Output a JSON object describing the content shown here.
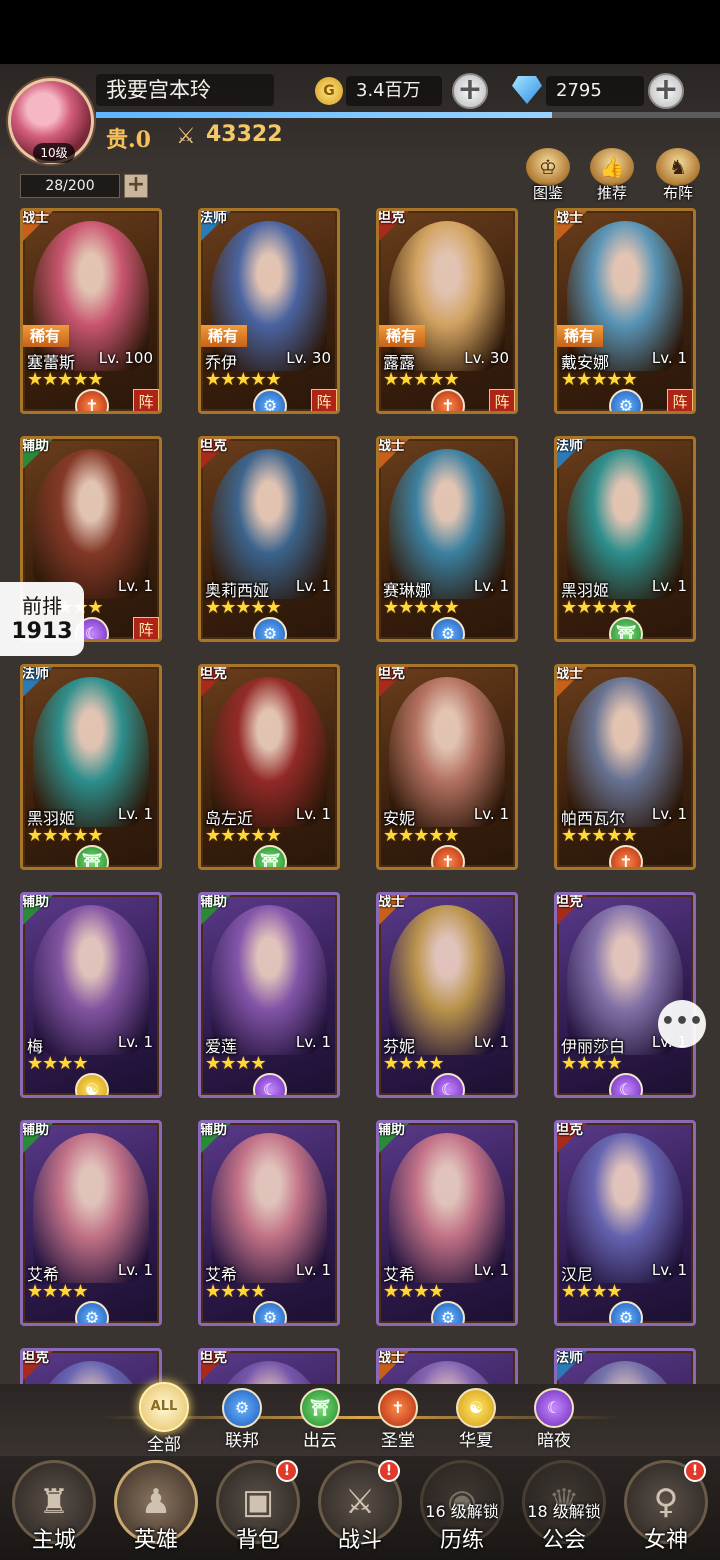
{
  "player": {
    "name": "我要宫本玲",
    "level": "10级",
    "vip": "贵.0",
    "power": "43322",
    "gold": "3.4百万",
    "gems": "2795",
    "exp_fraction": 0.73
  },
  "capacity": "28/200",
  "top_buttons": [
    {
      "label": "图鉴",
      "icon": "book-crown-icon"
    },
    {
      "label": "推荐",
      "icon": "thumbs-up-icon"
    },
    {
      "label": "布阵",
      "icon": "knight-icon"
    }
  ],
  "side_rank": {
    "label": "前排",
    "value": "1913"
  },
  "heroes": [
    {
      "role": "战士",
      "rare": "稀有",
      "name": "塞蕾斯",
      "lv": "Lv. 100",
      "stars": "★★★★★",
      "faction": "temple",
      "formation": true,
      "theme": "orange",
      "art": "#d65a7a"
    },
    {
      "role": "法师",
      "rare": "稀有",
      "name": "乔伊",
      "lv": "Lv. 30",
      "stars": "★★★★★",
      "faction": "union",
      "formation": true,
      "theme": "orange",
      "art": "#4a6ab0"
    },
    {
      "role": "坦克",
      "rare": "稀有",
      "name": "露露",
      "lv": "Lv. 30",
      "stars": "★★★★★",
      "faction": "temple",
      "formation": true,
      "theme": "orange",
      "art": "#e0b06a"
    },
    {
      "role": "战士",
      "rare": "稀有",
      "name": "戴安娜",
      "lv": "Lv. 1",
      "stars": "★★★★★",
      "faction": "union",
      "formation": true,
      "theme": "orange",
      "art": "#5aa0c8"
    },
    {
      "role": "辅助",
      "rare": "",
      "name": "",
      "lv": "Lv. 1",
      "stars": "★★★★★",
      "faction": "night",
      "formation": true,
      "theme": "orange",
      "art": "#8a3a2a"
    },
    {
      "role": "坦克",
      "rare": "",
      "name": "奥莉西娅",
      "lv": "Lv. 1",
      "stars": "★★★★★",
      "faction": "union",
      "formation": false,
      "theme": "orange",
      "art": "#3a6a9a"
    },
    {
      "role": "战士",
      "rare": "",
      "name": "赛琳娜",
      "lv": "Lv. 1",
      "stars": "★★★★★",
      "faction": "union",
      "formation": false,
      "theme": "orange",
      "art": "#3a8ab0"
    },
    {
      "role": "法师",
      "rare": "",
      "name": "黑羽姬",
      "lv": "Lv. 1",
      "stars": "★★★★★",
      "faction": "izumo",
      "formation": false,
      "theme": "orange",
      "art": "#2a9a9a"
    },
    {
      "role": "法师",
      "rare": "",
      "name": "黑羽姬",
      "lv": "Lv. 1",
      "stars": "★★★★★",
      "faction": "izumo",
      "formation": false,
      "theme": "orange",
      "art": "#2a9a9a"
    },
    {
      "role": "坦克",
      "rare": "",
      "name": "岛左近",
      "lv": "Lv. 1",
      "stars": "★★★★★",
      "faction": "izumo",
      "formation": false,
      "theme": "orange",
      "art": "#9a2a2a"
    },
    {
      "role": "坦克",
      "rare": "",
      "name": "安妮",
      "lv": "Lv. 1",
      "stars": "★★★★★",
      "faction": "temple",
      "formation": false,
      "theme": "orange",
      "art": "#c07a6a"
    },
    {
      "role": "战士",
      "rare": "",
      "name": "帕西瓦尔",
      "lv": "Lv. 1",
      "stars": "★★★★★",
      "faction": "temple",
      "formation": false,
      "theme": "orange",
      "art": "#6a7aa0"
    },
    {
      "role": "辅助",
      "rare": "",
      "name": "梅",
      "lv": "Lv. 1",
      "stars": "★★★★",
      "faction": "huaxia",
      "formation": false,
      "theme": "purple",
      "art": "#8a5aa8"
    },
    {
      "role": "辅助",
      "rare": "",
      "name": "爱莲",
      "lv": "Lv. 1",
      "stars": "★★★★",
      "faction": "night",
      "formation": false,
      "theme": "purple",
      "art": "#8a5ab0"
    },
    {
      "role": "战士",
      "rare": "",
      "name": "芬妮",
      "lv": "Lv. 1",
      "stars": "★★★★",
      "faction": "night",
      "formation": false,
      "theme": "purple",
      "art": "#c8a04a"
    },
    {
      "role": "坦克",
      "rare": "",
      "name": "伊丽莎白",
      "lv": "Lv. 1",
      "stars": "★★★★",
      "faction": "night",
      "formation": false,
      "theme": "purple",
      "art": "#8a7ab0"
    },
    {
      "role": "辅助",
      "rare": "",
      "name": "艾希",
      "lv": "Lv. 1",
      "stars": "★★★★",
      "faction": "union",
      "formation": false,
      "theme": "purple",
      "art": "#d07a8a"
    },
    {
      "role": "辅助",
      "rare": "",
      "name": "艾希",
      "lv": "Lv. 1",
      "stars": "★★★★",
      "faction": "union",
      "formation": false,
      "theme": "purple",
      "art": "#d07a8a"
    },
    {
      "role": "辅助",
      "rare": "",
      "name": "艾希",
      "lv": "Lv. 1",
      "stars": "★★★★",
      "faction": "union",
      "formation": false,
      "theme": "purple",
      "art": "#d07a8a"
    },
    {
      "role": "坦克",
      "rare": "",
      "name": "汉尼",
      "lv": "Lv. 1",
      "stars": "★★★★",
      "faction": "union",
      "formation": false,
      "theme": "purple",
      "art": "#6a6ab8"
    },
    {
      "role": "坦克",
      "rare": "",
      "name": "",
      "lv": "",
      "stars": "",
      "faction": "",
      "formation": false,
      "theme": "purple",
      "art": "#6a6ab8"
    },
    {
      "role": "坦克",
      "rare": "",
      "name": "",
      "lv": "",
      "stars": "",
      "faction": "",
      "formation": false,
      "theme": "purple",
      "art": "#7a5ab0"
    },
    {
      "role": "战士",
      "rare": "",
      "name": "",
      "lv": "",
      "stars": "",
      "faction": "",
      "formation": false,
      "theme": "purple",
      "art": "#8a6ab8"
    },
    {
      "role": "法师",
      "rare": "",
      "name": "",
      "lv": "",
      "stars": "",
      "faction": "",
      "formation": false,
      "theme": "purple",
      "art": "#7a7ab0"
    }
  ],
  "formation_label": "阵",
  "factions": [
    {
      "key": "all",
      "label": "全部",
      "icon_text": "ALL",
      "active": true
    },
    {
      "key": "union",
      "label": "联邦",
      "icon_text": "⚙",
      "active": false
    },
    {
      "key": "izumo",
      "label": "出云",
      "icon_text": "⛩",
      "active": false
    },
    {
      "key": "temple",
      "label": "圣堂",
      "icon_text": "✝",
      "active": false
    },
    {
      "key": "huaxia",
      "label": "华夏",
      "icon_text": "☯",
      "active": false
    },
    {
      "key": "night",
      "label": "暗夜",
      "icon_text": "☾",
      "active": false
    }
  ],
  "faction_icons": {
    "union": "⚙",
    "izumo": "⛩",
    "temple": "✝",
    "huaxia": "☯",
    "night": "☾"
  },
  "nav": [
    {
      "label": "主城",
      "icon": "castle-icon",
      "glyph": "♜",
      "active": false,
      "badge": false,
      "lock": ""
    },
    {
      "label": "英雄",
      "icon": "hero-hood-icon",
      "glyph": "♟",
      "active": true,
      "badge": false,
      "lock": ""
    },
    {
      "label": "背包",
      "icon": "backpack-icon",
      "glyph": "▣",
      "active": false,
      "badge": true,
      "lock": ""
    },
    {
      "label": "战斗",
      "icon": "crossed-swords-icon",
      "glyph": "⚔",
      "active": false,
      "badge": true,
      "lock": ""
    },
    {
      "label": "历练",
      "icon": "map-pin-icon",
      "glyph": "◉",
      "active": false,
      "badge": false,
      "lock": "16 级解锁"
    },
    {
      "label": "公会",
      "icon": "crown-icon",
      "glyph": "♛",
      "active": false,
      "badge": false,
      "lock": "18 级解锁"
    },
    {
      "label": "女神",
      "icon": "goddess-icon",
      "glyph": "♀",
      "active": false,
      "badge": true,
      "lock": ""
    }
  ],
  "badge_text": "!",
  "chat_icon_text": "•••"
}
